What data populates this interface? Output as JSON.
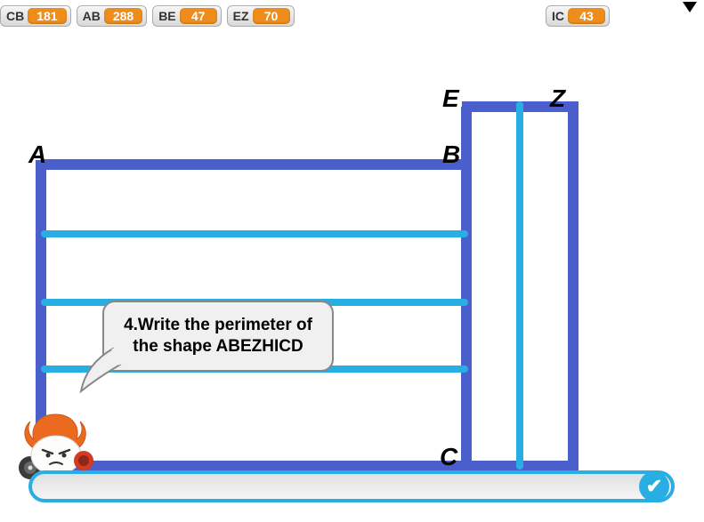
{
  "segments": [
    {
      "label": "CB",
      "value": "181"
    },
    {
      "label": "AB",
      "value": "288"
    },
    {
      "label": "BE",
      "value": "47"
    },
    {
      "label": "EZ",
      "value": "70"
    }
  ],
  "segment_ic": {
    "label": "IC",
    "value": "43"
  },
  "vertices": {
    "A": "A",
    "B": "B",
    "E": "E",
    "Z": "Z",
    "C": "C"
  },
  "question": "4.Write the perimeter of the shape  ABEZHICD",
  "answer": {
    "value": "",
    "placeholder": ""
  },
  "icons": {
    "submit": "✔"
  }
}
